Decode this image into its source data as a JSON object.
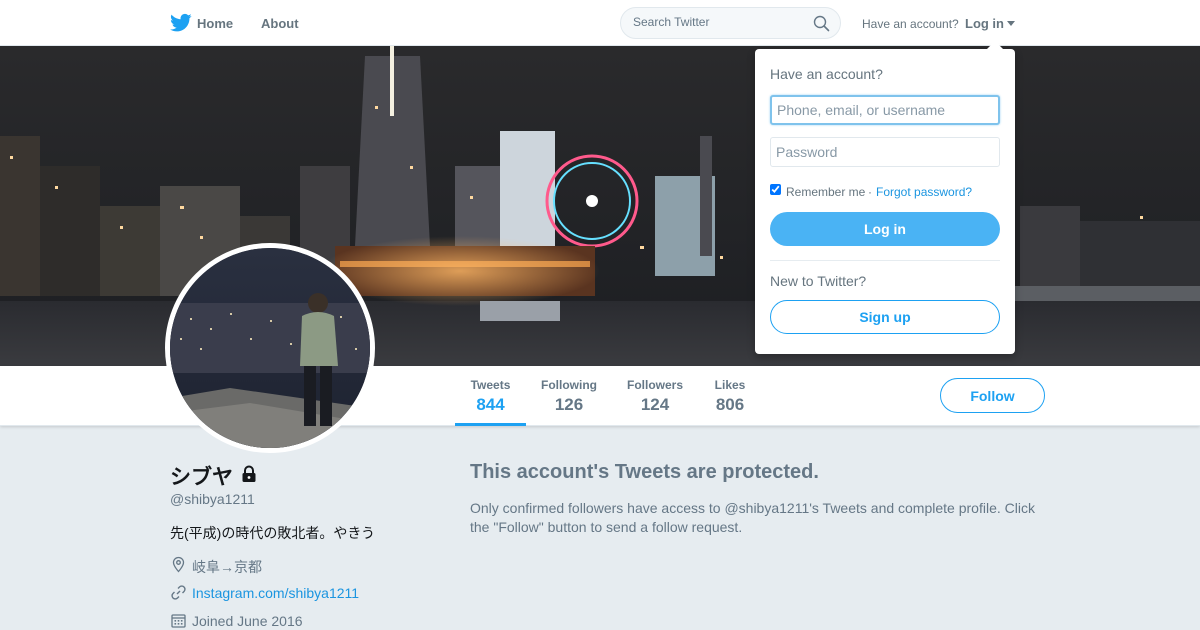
{
  "nav": {
    "home_label": "Home",
    "about_label": "About",
    "search_placeholder": "Search Twitter",
    "have_account": "Have an account?",
    "login_label": "Log in"
  },
  "colors": {
    "brand": "#1da1f2",
    "muted_text": "#657786",
    "page_bg": "#e6ecf0",
    "login_button_bg": "#4ab3f4"
  },
  "icons": {
    "logo": "twitter-bird-icon",
    "search": "search-icon",
    "dropdown": "caret-down-icon",
    "protected": "lock-icon",
    "location": "location-pin-icon",
    "website": "link-icon",
    "joined": "calendar-icon"
  },
  "stats": [
    {
      "label": "Tweets",
      "value": "844",
      "active": true
    },
    {
      "label": "Following",
      "value": "126",
      "active": false
    },
    {
      "label": "Followers",
      "value": "124",
      "active": false
    },
    {
      "label": "Likes",
      "value": "806",
      "active": false
    }
  ],
  "follow_label": "Follow",
  "profile": {
    "name": "シブヤ",
    "handle": "@shibya1211",
    "bio": "先(平成)の時代の敗北者。やきう",
    "location": "岐阜→京都",
    "website": "Instagram.com/shibya1211",
    "joined": "Joined June 2016"
  },
  "protected": {
    "title": "This account's Tweets are protected.",
    "text": "Only confirmed followers have access to @shibya1211's Tweets and complete profile. Click the \"Follow\" button to send a follow request."
  },
  "login_dropdown": {
    "heading": "Have an account?",
    "username_placeholder": "Phone, email, or username",
    "password_placeholder": "Password",
    "remember_label": "Remember me",
    "remember_checked": true,
    "separator": "·",
    "forgot_label": "Forgot password?",
    "login_button": "Log in",
    "new_prompt": "New to Twitter?",
    "signup_button": "Sign up"
  }
}
